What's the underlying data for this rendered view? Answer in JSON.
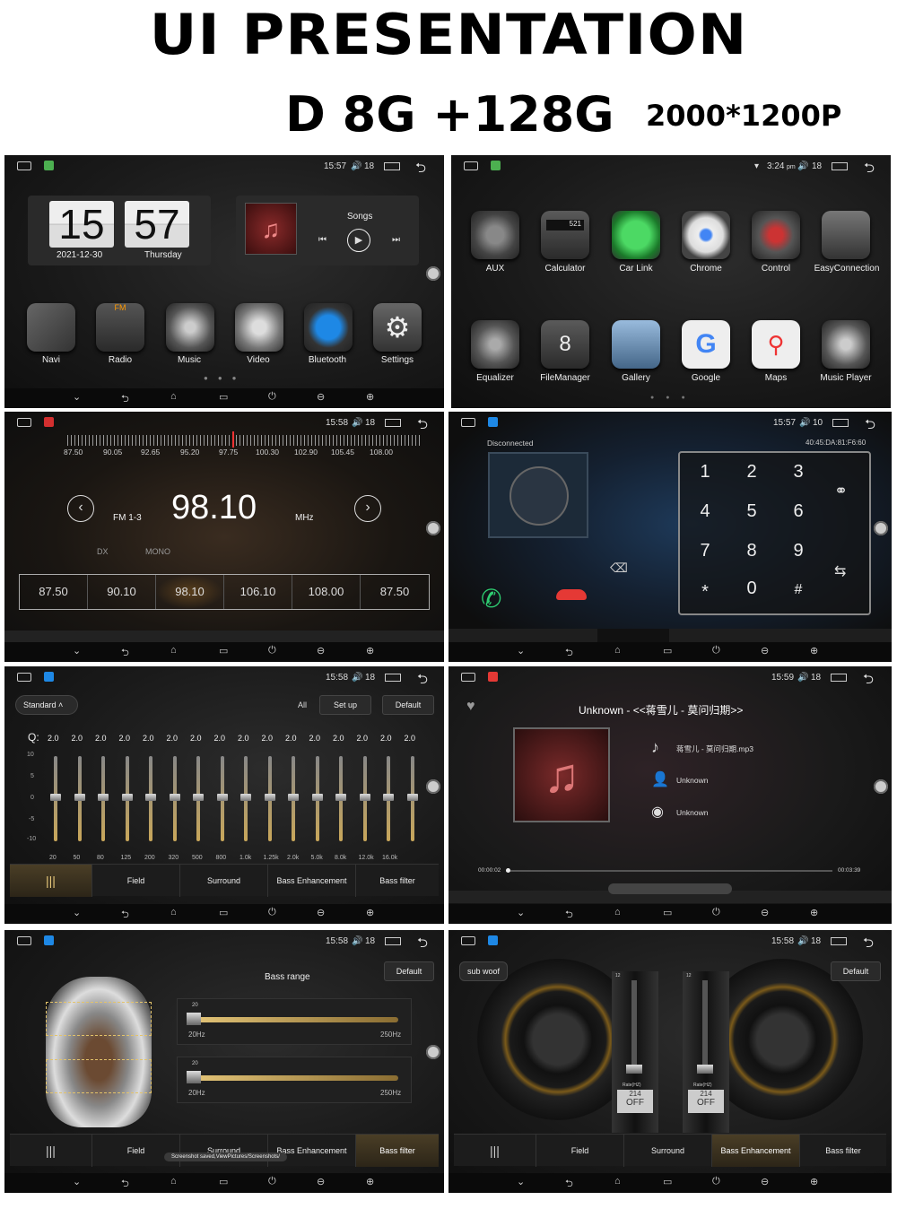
{
  "header": {
    "title": "UI PRESENTATION",
    "spec": "D 8G +128G",
    "resolution": "2000*1200P"
  },
  "nav_icons": {
    "down": "⌄",
    "back": "⮌",
    "home": "⌂",
    "recent": "▭",
    "power": "⏻",
    "vol_down": "⊖",
    "vol_up": "⊕"
  },
  "s1": {
    "time": "15:57",
    "vol": "18",
    "clock_h": "15",
    "clock_m": "57",
    "date": "2021-12-30",
    "day": "Thursday",
    "songs": "Songs",
    "apps": [
      "Navi",
      "Radio",
      "Music",
      "Video",
      "Bluetooth",
      "Settings"
    ]
  },
  "s2": {
    "time": "3:24",
    "ampm": "pm",
    "vol": "18",
    "calc_display": "521",
    "apps_row1": [
      "AUX",
      "Calculator",
      "Car Link",
      "Chrome",
      "Control",
      "EasyConnection"
    ],
    "apps_row2": [
      "Equalizer",
      "FileManager",
      "Gallery",
      "Google",
      "Maps",
      "Music Player"
    ]
  },
  "s3": {
    "time": "15:58",
    "vol": "18",
    "scale": [
      "87.50",
      "90.05",
      "92.65",
      "95.20",
      "97.75",
      "100.30",
      "102.90",
      "105.45",
      "108.00"
    ],
    "band": "FM 1-3",
    "freq": "98.10",
    "unit": "MHz",
    "dx": "DX",
    "mono": "MONO",
    "presets": [
      "87.50",
      "90.10",
      "98.10",
      "106.10",
      "108.00",
      "87.50"
    ]
  },
  "s4": {
    "time": "15:57",
    "vol": "10",
    "status": "Disconnected",
    "mac": "40:45:DA:81:F6:60",
    "keys": [
      "1",
      "2",
      "3",
      "4",
      "5",
      "6",
      "7",
      "8",
      "9",
      "*",
      "0",
      "#"
    ]
  },
  "s5": {
    "time": "15:58",
    "vol": "18",
    "preset": "Standard",
    "all": "All",
    "setup": "Set up",
    "default": "Default",
    "q_label": "Q:",
    "q_values": [
      "2.0",
      "2.0",
      "2.0",
      "2.0",
      "2.0",
      "2.0",
      "2.0",
      "2.0",
      "2.0",
      "2.0",
      "2.0",
      "2.0",
      "2.0",
      "2.0",
      "2.0",
      "2.0"
    ],
    "scale": [
      "10",
      "5",
      "0",
      "-5",
      "-10"
    ],
    "freqs": [
      "20",
      "50",
      "80",
      "125",
      "200",
      "320",
      "500",
      "800",
      "1.0k",
      "1.25k",
      "2.0k",
      "5.0k",
      "8.0k",
      "12.0k",
      "16.0k"
    ],
    "tabs": [
      "Field",
      "Surround",
      "Bass Enhancement",
      "Bass filter"
    ]
  },
  "s6": {
    "time": "15:59",
    "vol": "18",
    "title": "Unknown - <<蒋雪儿 - 莫问归期>>",
    "file": "蒋雪儿 - 莫问归期.mp3",
    "artist": "Unknown",
    "album": "Unknown",
    "elapsed": "00:00:02",
    "total": "00:03:39"
  },
  "s7": {
    "time": "15:58",
    "vol": "18",
    "heading": "Bass range",
    "default": "Default",
    "slider_top": "20",
    "min": "20Hz",
    "max": "250Hz",
    "tabs": [
      "Field",
      "Surround",
      "Bass Enhancement",
      "Bass filter"
    ],
    "toast": "Screenshot saved,ViewPictures/Screenshots/"
  },
  "s8": {
    "time": "15:58",
    "vol": "18",
    "subwoof": "sub woof",
    "default": "Default",
    "rate_label": "Rate(HZ)",
    "rate": "214",
    "off": "OFF",
    "top": "12",
    "tabs": [
      "Field",
      "Surround",
      "Bass Enhancement",
      "Bass filter"
    ]
  }
}
